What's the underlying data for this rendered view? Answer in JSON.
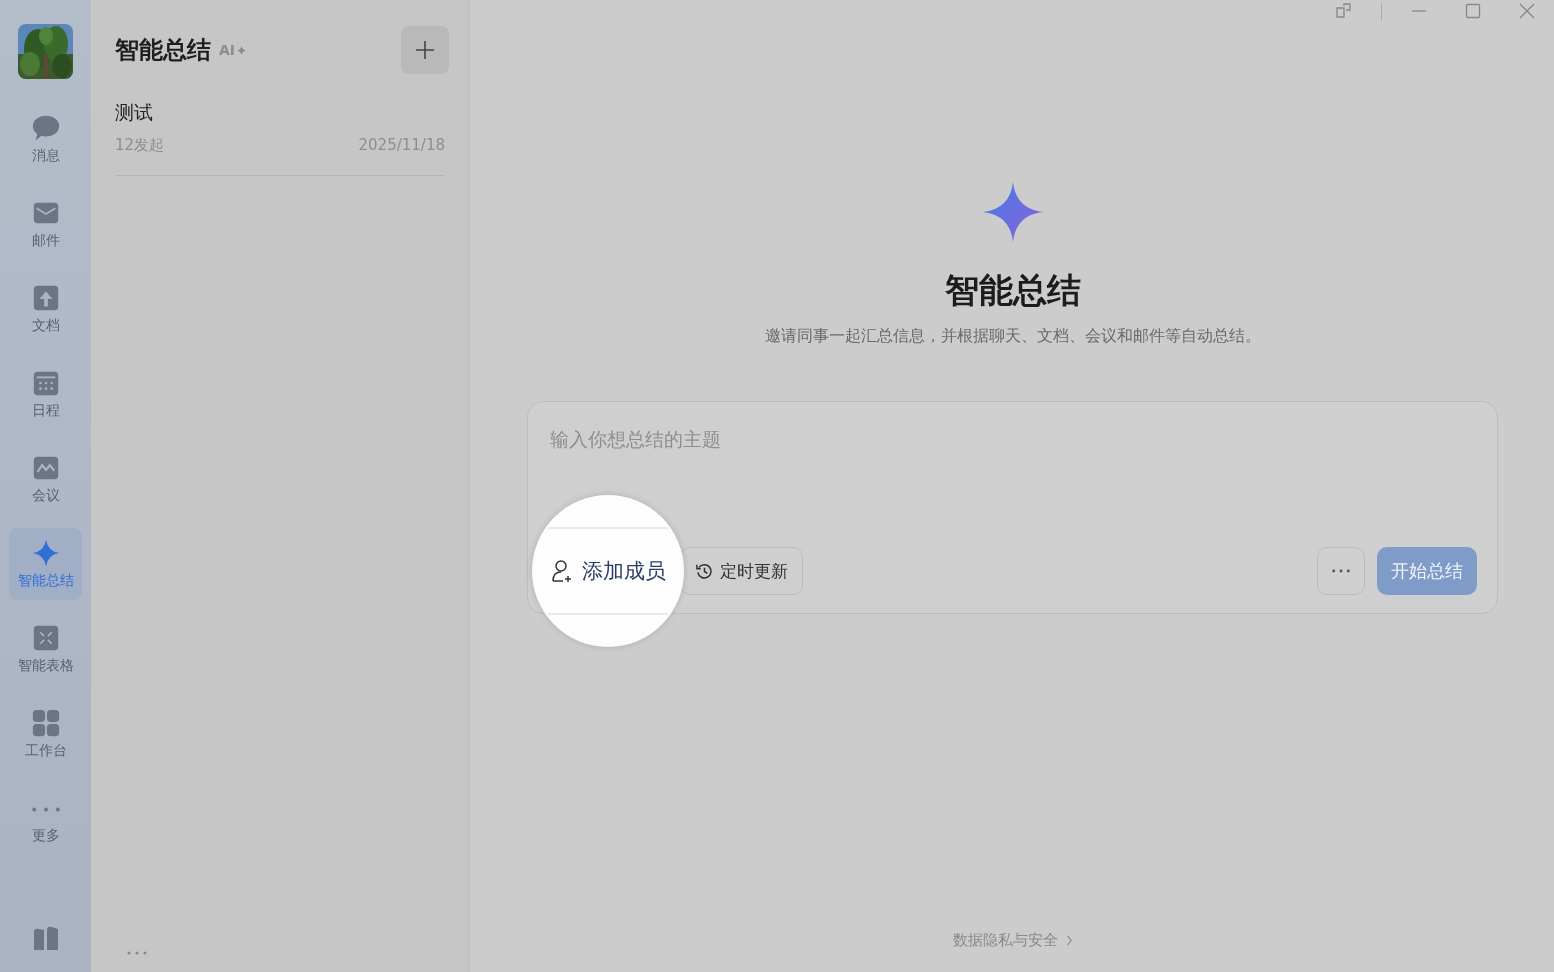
{
  "sidebar": {
    "items": [
      {
        "label": "消息",
        "kind": "chat",
        "selected": false
      },
      {
        "label": "邮件",
        "kind": "mail",
        "selected": false
      },
      {
        "label": "文档",
        "kind": "doc",
        "selected": false
      },
      {
        "label": "日程",
        "kind": "calendar",
        "selected": false
      },
      {
        "label": "会议",
        "kind": "meeting",
        "selected": false
      },
      {
        "label": "智能总结",
        "kind": "sparkle",
        "selected": true
      },
      {
        "label": "智能表格",
        "kind": "table",
        "selected": false
      },
      {
        "label": "工作台",
        "kind": "grid",
        "selected": false
      },
      {
        "label": "更多",
        "kind": "more",
        "selected": false
      }
    ]
  },
  "list_panel": {
    "title": "智能总结",
    "badge": "AI",
    "entries": [
      {
        "title": "测试",
        "subtitle": "12发起",
        "date": "2025/11/18"
      }
    ]
  },
  "main": {
    "heading": "智能总结",
    "subtitle": "邀请同事一起汇总信息，并根据聊天、文档、会议和邮件等自动总结。",
    "composer": {
      "placeholder": "输入你想总结的主题",
      "add_member": {
        "label": "添加成员",
        "highlighted": true
      },
      "schedule": {
        "label": "定时更新"
      },
      "start": {
        "label": "开始总结",
        "disabled": true
      }
    },
    "footer_link": "数据隐私与安全"
  }
}
